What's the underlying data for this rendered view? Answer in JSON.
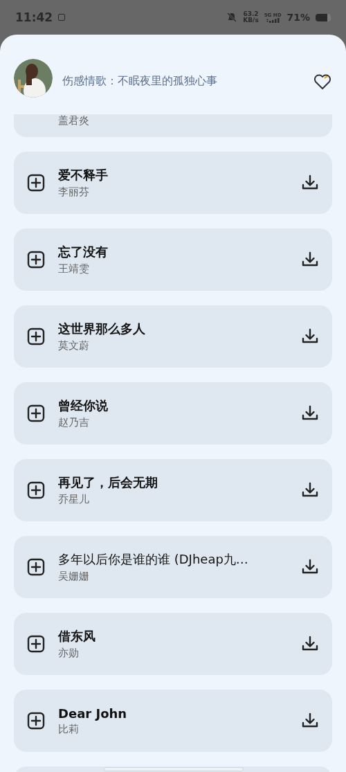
{
  "status_bar": {
    "time": "11:42",
    "speed_value": "63.2",
    "speed_unit": "KB/s",
    "network": "5G HD",
    "battery": "71%"
  },
  "header": {
    "title": "伤感情歌：不眠夜里的孤独心事",
    "favorited": false
  },
  "songs": [
    {
      "artist": "盖君炎",
      "partial": true
    },
    {
      "title": "爱不释手",
      "artist": "李丽芬",
      "partial": false
    },
    {
      "title": "忘了没有",
      "artist": "王靖雯",
      "partial": false
    },
    {
      "title": "这世界那么多人",
      "artist": "莫文蔚",
      "partial": false
    },
    {
      "title": "曾经你说",
      "artist": "赵乃吉",
      "partial": false
    },
    {
      "title": "再见了，后会无期",
      "artist": "乔星儿",
      "partial": false
    },
    {
      "title": "多年以后你是谁的谁 (DJheap九…",
      "artist": "吴姗姗",
      "partial": false
    },
    {
      "title": "借东风",
      "artist": "亦勋",
      "partial": false
    },
    {
      "title": "Dear John",
      "artist": "比莉",
      "partial": false
    }
  ]
}
